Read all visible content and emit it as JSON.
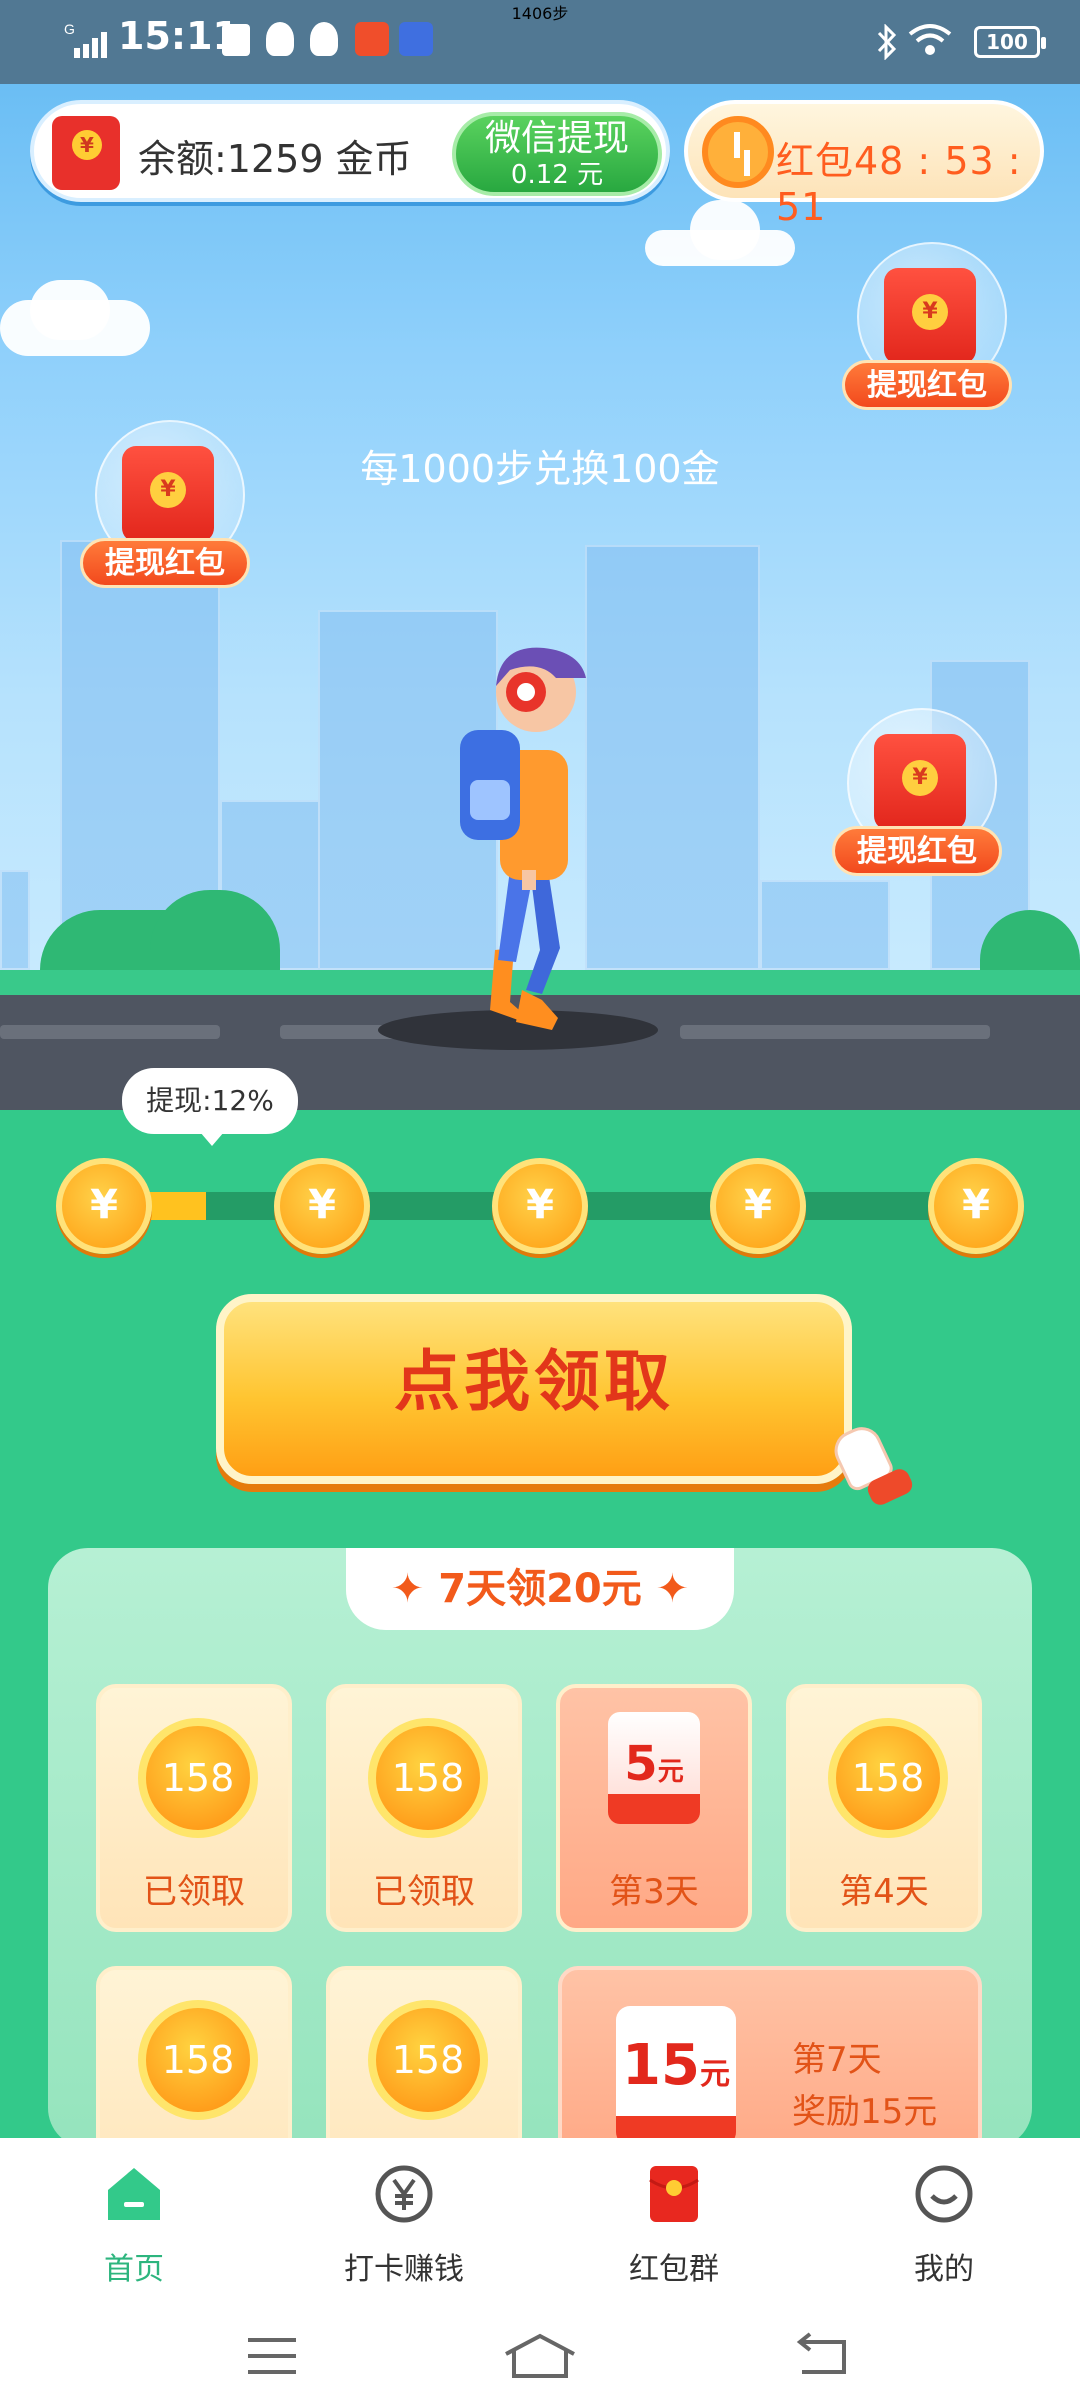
{
  "status_bar": {
    "time": "15:11",
    "signal_label": "G",
    "battery": "100",
    "icons": [
      "wechat-check-icon",
      "qq-icon",
      "qq-icon",
      "app-icon",
      "sport-app-icon",
      "bluetooth-icon",
      "wifi-icon"
    ]
  },
  "top": {
    "balance_text": "余额:1259 金币",
    "withdraw_btn": {
      "title": "微信提现",
      "amount": "0.12 元"
    },
    "timer_text": "红包48 : 53 : 51"
  },
  "steps": {
    "count": "1406",
    "unit": "步",
    "subtitle": "每1000步兑换100金"
  },
  "floating_redpacks": [
    "提现红包",
    "提现红包",
    "提现红包"
  ],
  "progress": {
    "tooltip": "提现:12%",
    "percent": 12,
    "coin_symbol": "¥",
    "coin_count": 5
  },
  "claim_button": {
    "label": "点我领取"
  },
  "checkin": {
    "title": "✦ 7天领20元 ✦",
    "cards": [
      {
        "coin": "158",
        "label": "已领取"
      },
      {
        "coin": "158",
        "label": "已领取"
      },
      {
        "reward": "5",
        "unit": "元",
        "label": "第3天"
      },
      {
        "coin": "158",
        "label": "第4天"
      },
      {
        "coin": "158",
        "label": ""
      },
      {
        "coin": "158",
        "label": ""
      }
    ],
    "big_reward": {
      "amount": "15",
      "unit": "元",
      "day": "第7天",
      "desc": "奖励15元"
    }
  },
  "tabs": [
    {
      "label": "首页",
      "icon": "home-icon",
      "active": true
    },
    {
      "label": "打卡赚钱",
      "icon": "yen-coin-icon",
      "active": false
    },
    {
      "label": "红包群",
      "icon": "red-envelope-icon",
      "active": false
    },
    {
      "label": "我的",
      "icon": "smile-profile-icon",
      "active": false
    }
  ],
  "colors": {
    "accent_green": "#33c98a",
    "brand_red": "#e2281c",
    "active_tab": "#2db57e"
  }
}
